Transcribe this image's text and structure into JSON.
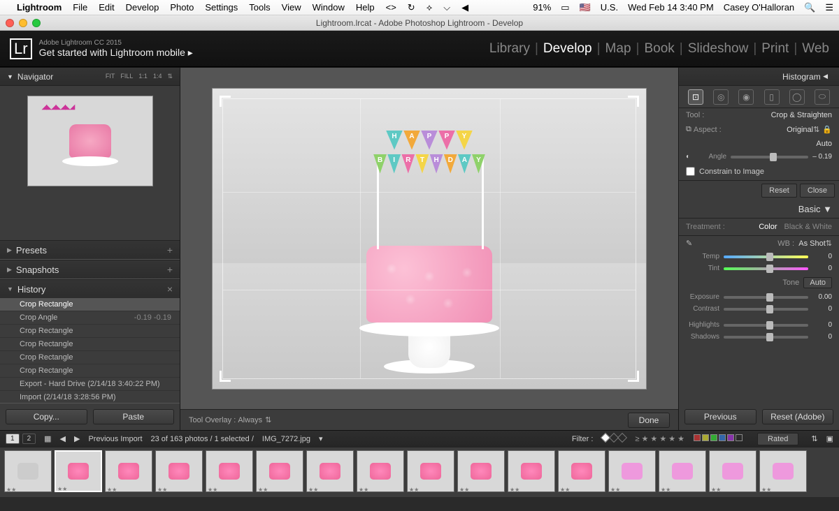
{
  "menubar": {
    "app": "Lightroom",
    "items": [
      "File",
      "Edit",
      "Develop",
      "Photo",
      "Settings",
      "Tools",
      "View",
      "Window",
      "Help"
    ],
    "battery": "91%",
    "locale": "U.S.",
    "datetime": "Wed Feb 14  3:40 PM",
    "user": "Casey O'Halloran"
  },
  "window_title": "Lightroom.lrcat - Adobe Photoshop Lightroom - Develop",
  "appheader": {
    "badge": "Lr",
    "version": "Adobe Lightroom CC 2015",
    "subtitle": "Get started with Lightroom mobile  ▸"
  },
  "modules": [
    "Library",
    "Develop",
    "Map",
    "Book",
    "Slideshow",
    "Print",
    "Web"
  ],
  "active_module": "Develop",
  "navigator": {
    "title": "Navigator",
    "opts": [
      "FIT",
      "FILL",
      "1:1",
      "1:4"
    ]
  },
  "presets": {
    "title": "Presets"
  },
  "snapshots": {
    "title": "Snapshots"
  },
  "history": {
    "title": "History",
    "items": [
      {
        "label": "Crop Rectangle",
        "val": "",
        "sel": true
      },
      {
        "label": "Crop Angle",
        "val": "-0.19   -0.19"
      },
      {
        "label": "Crop Rectangle",
        "val": ""
      },
      {
        "label": "Crop Rectangle",
        "val": ""
      },
      {
        "label": "Crop Rectangle",
        "val": ""
      },
      {
        "label": "Crop Rectangle",
        "val": ""
      },
      {
        "label": "Export - Hard Drive (2/14/18 3:40:22 PM)",
        "val": ""
      },
      {
        "label": "Import (2/14/18 3:28:56 PM)",
        "val": ""
      }
    ]
  },
  "copy_btn": "Copy...",
  "paste_btn": "Paste",
  "center": {
    "overlay_label": "Tool Overlay :",
    "overlay_value": "Always",
    "done": "Done"
  },
  "right": {
    "histogram": "Histogram",
    "tool_label": "Tool :",
    "tool_value": "Crop & Straighten",
    "aspect_label": "Aspect :",
    "aspect_value": "Original",
    "auto": "Auto",
    "angle_label": "Angle",
    "angle_value": "– 0.19",
    "constrain": "Constrain to Image",
    "reset": "Reset",
    "close": "Close",
    "basic": "Basic",
    "treatment": "Treatment :",
    "color": "Color",
    "bw": "Black & White",
    "wb_label": "WB :",
    "wb_value": "As Shot",
    "temp": "Temp",
    "temp_val": "0",
    "tint": "Tint",
    "tint_val": "0",
    "tone": "Tone",
    "exposure": "Exposure",
    "exposure_val": "0.00",
    "contrast": "Contrast",
    "contrast_val": "0",
    "highlights": "Highlights",
    "highlights_val": "0",
    "shadows": "Shadows",
    "shadows_val": "0",
    "previous": "Previous",
    "reset_adobe": "Reset (Adobe)"
  },
  "filter": {
    "source": "Previous Import",
    "count": "23 of 163 photos / 1 selected /",
    "filename": "IMG_7272.jpg",
    "label": "Filter :",
    "rated": "Rated"
  },
  "banner_top": [
    "H",
    "A",
    "P",
    "P",
    "Y"
  ],
  "banner_bottom": [
    "B",
    "I",
    "R",
    "T",
    "H",
    "D",
    "A",
    "Y"
  ]
}
